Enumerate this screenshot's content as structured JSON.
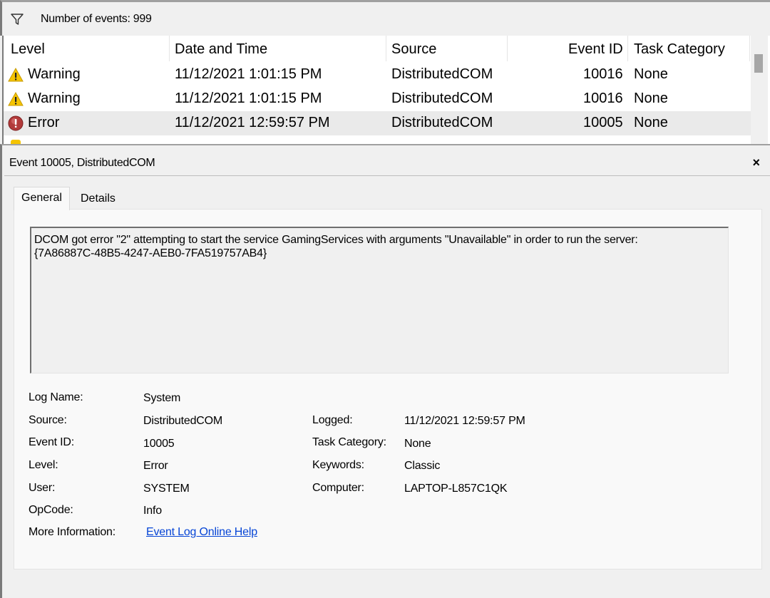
{
  "filter_bar": {
    "icon": "filter-icon",
    "count_text": "Number of events: 999"
  },
  "list": {
    "columns": [
      "Level",
      "Date and Time",
      "Source",
      "Event ID",
      "Task Category"
    ],
    "rows": [
      {
        "icon": "warning-icon",
        "level": "Warning",
        "datetime": "11/12/2021 1:01:15 PM",
        "source": "DistributedCOM",
        "event_id": "10016",
        "task_category": "None"
      },
      {
        "icon": "warning-icon",
        "level": "Warning",
        "datetime": "11/12/2021 1:01:15 PM",
        "source": "DistributedCOM",
        "event_id": "10016",
        "task_category": "None"
      },
      {
        "icon": "error-icon",
        "level": "Error",
        "datetime": "11/12/2021 12:59:57 PM",
        "source": "DistributedCOM",
        "event_id": "10005",
        "task_category": "None"
      }
    ]
  },
  "detail": {
    "title": "Event 10005, DistributedCOM",
    "close_label": "×",
    "tabs": [
      {
        "label": "General"
      },
      {
        "label": "Details"
      }
    ],
    "description": "DCOM got error \"2\" attempting to start the service GamingServices with arguments \"Unavailable\" in order to run the server:\n{7A86887C-48B5-4247-AEB0-7FA519757AB4}",
    "props": {
      "log_name_label": "Log Name:",
      "log_name": "System",
      "source_label": "Source:",
      "source": "DistributedCOM",
      "event_id_label": "Event ID:",
      "event_id": "10005",
      "level_label": "Level:",
      "level": "Error",
      "user_label": "User:",
      "user": "SYSTEM",
      "opcode_label": "OpCode:",
      "opcode": "Info",
      "more_info_label": "More Information:",
      "more_info_link": "Event Log Online Help",
      "logged_label": "Logged:",
      "logged": "11/12/2021 12:59:57 PM",
      "task_category_label": "Task Category:",
      "task_category": "None",
      "keywords_label": "Keywords:",
      "keywords": "Classic",
      "computer_label": "Computer:",
      "computer": "LAPTOP-L857C1QK"
    }
  },
  "colors": {
    "warning": "#f5c400",
    "error": "#c0392b",
    "link": "#0645d6",
    "selected_row": "#eaeaea"
  }
}
